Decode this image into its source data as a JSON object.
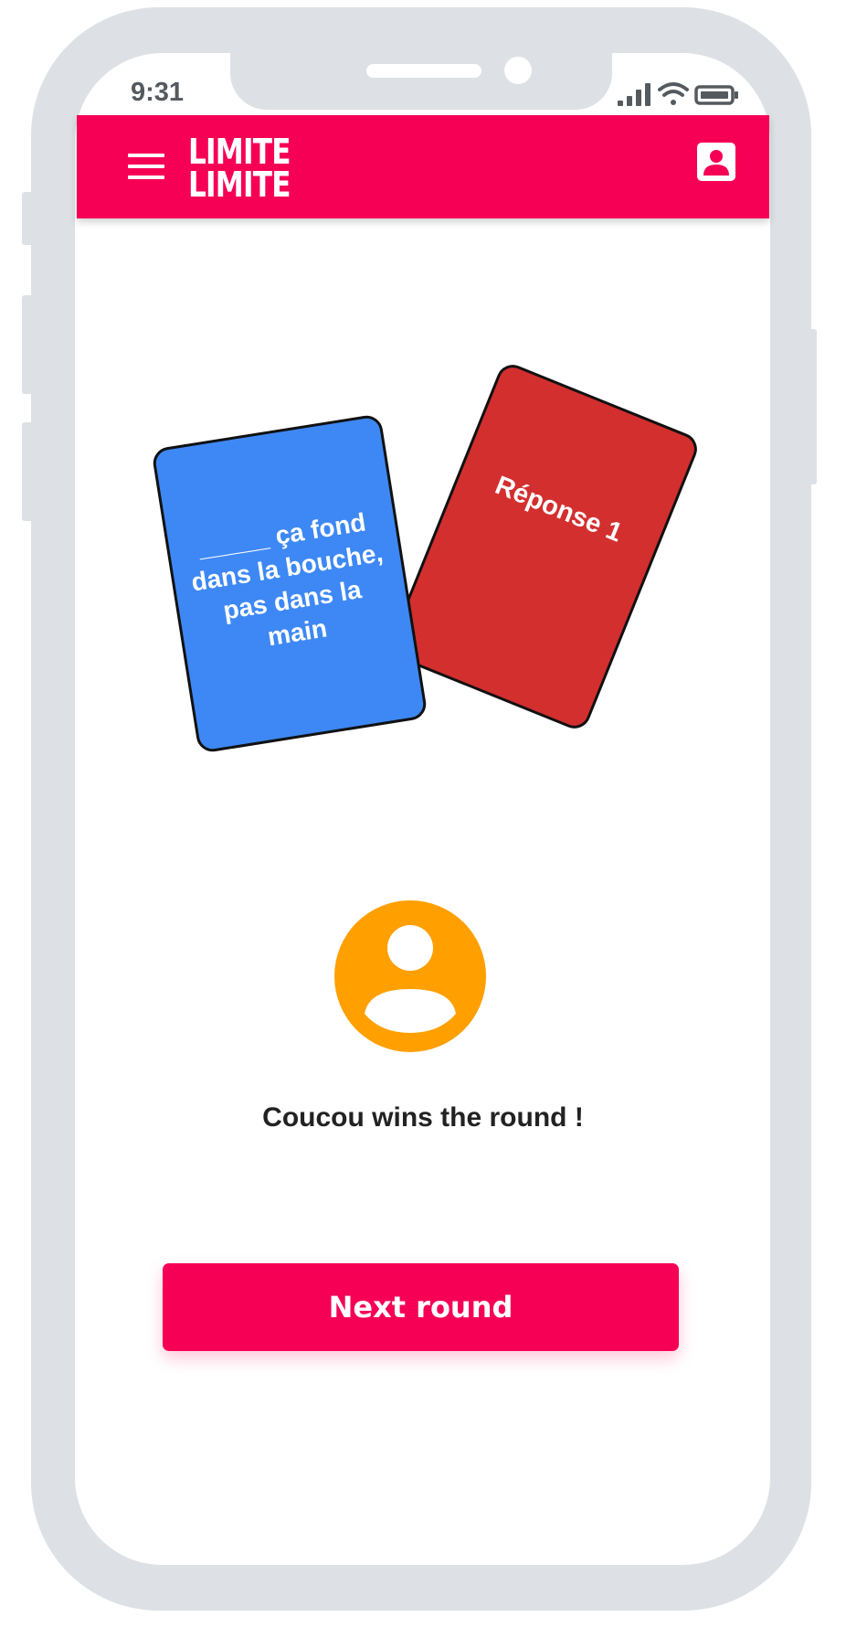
{
  "status_bar": {
    "time": "9:31"
  },
  "app_bar": {
    "logo_line1": "LIMITE",
    "logo_line2": "LIMITE",
    "menu_icon": "hamburger-menu-icon",
    "profile_icon": "account-box-icon"
  },
  "cards": {
    "question_text": "_____ ça fond dans la bouche, pas dans la main",
    "answer_text": "Réponse 1"
  },
  "winner": {
    "avatar_icon": "account-circle-icon",
    "message": "Coucou wins the round !"
  },
  "next_button": {
    "label": "Next round"
  },
  "colors": {
    "brand_pink": "#f60055",
    "question_card_blue": "#3d88f4",
    "answer_card_red": "#d32f2f",
    "avatar_orange": "#ff9f00",
    "frame_gray": "#dde1e6"
  }
}
